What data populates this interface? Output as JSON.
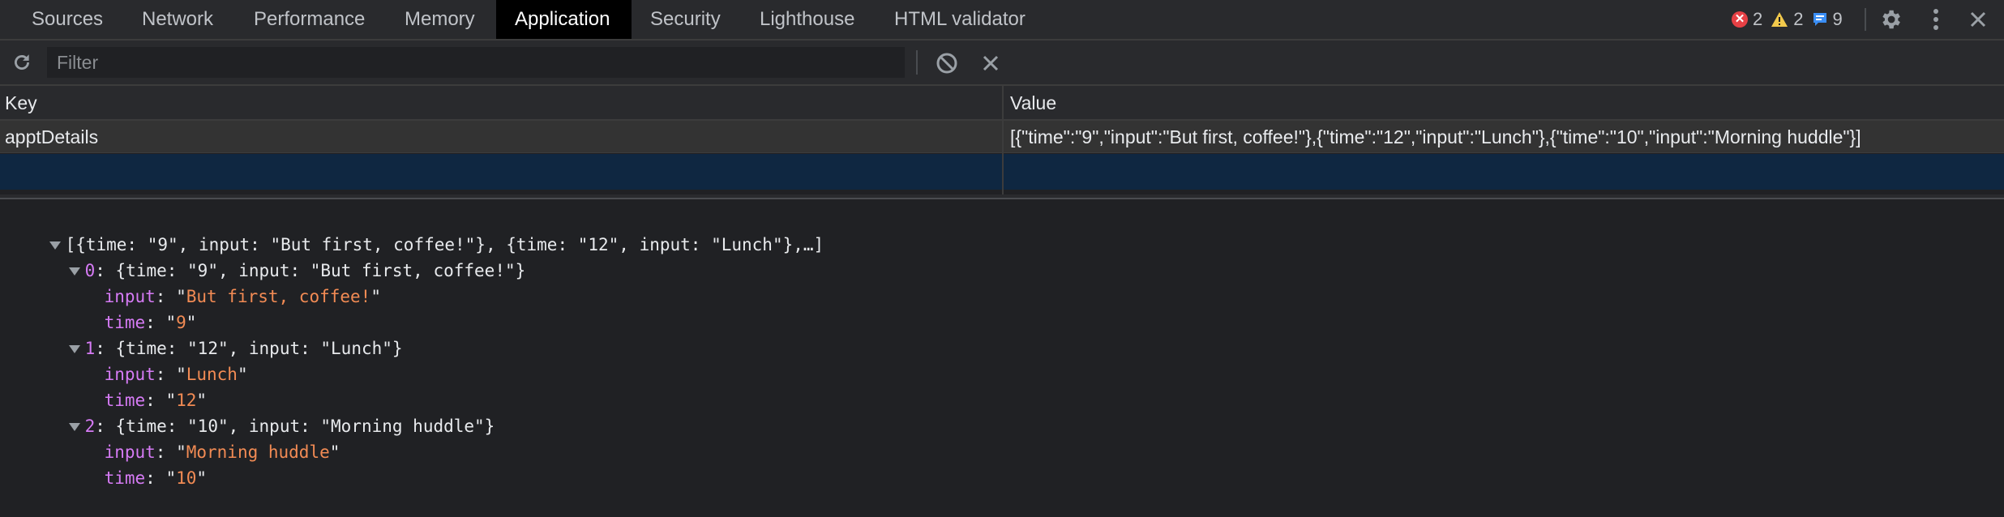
{
  "tabs": [
    {
      "label": "Sources",
      "active": false
    },
    {
      "label": "Network",
      "active": false
    },
    {
      "label": "Performance",
      "active": false
    },
    {
      "label": "Memory",
      "active": false
    },
    {
      "label": "Application",
      "active": true
    },
    {
      "label": "Security",
      "active": false
    },
    {
      "label": "Lighthouse",
      "active": false
    },
    {
      "label": "HTML validator",
      "active": false
    }
  ],
  "status": {
    "errors": "2",
    "warnings": "2",
    "messages": "9",
    "error_symbol": "✕"
  },
  "icons": {
    "settings": "gear-icon",
    "more": "more-vertical-icon",
    "close": "close-icon",
    "refresh": "refresh-icon",
    "clear": "block-icon",
    "delete": "close-icon"
  },
  "toolbar": {
    "filter_placeholder": "Filter"
  },
  "grid": {
    "headers": {
      "key": "Key",
      "value": "Value"
    },
    "rows": [
      {
        "key": "apptDetails",
        "value": "[{\"time\":\"9\",\"input\":\"But first, coffee!\"},{\"time\":\"12\",\"input\":\"Lunch\"},{\"time\":\"10\",\"input\":\"Morning huddle\"}]"
      }
    ]
  },
  "preview": {
    "root_summary": "[{time: \"9\", input: \"But first, coffee!\"}, {time: \"12\", input: \"Lunch\"},…]",
    "items": [
      {
        "index": "0",
        "summary": "{time: \"9\", input: \"But first, coffee!\"}",
        "input": "But first, coffee!",
        "time": "9"
      },
      {
        "index": "1",
        "summary": "{time: \"12\", input: \"Lunch\"}",
        "input": "Lunch",
        "time": "12"
      },
      {
        "index": "2",
        "summary": "{time: \"10\", input: \"Morning huddle\"}",
        "input": "Morning huddle",
        "time": "10"
      }
    ],
    "key_input": "input",
    "key_time": "time"
  },
  "colors": {
    "background": "#202124",
    "active_tab": "#000000",
    "selected_row": "#0f2741",
    "error": "#e64045",
    "warning": "#f2c94c",
    "info": "#3a8ef6",
    "key_purple": "#d67bf5",
    "string_orange": "#f28b54"
  }
}
